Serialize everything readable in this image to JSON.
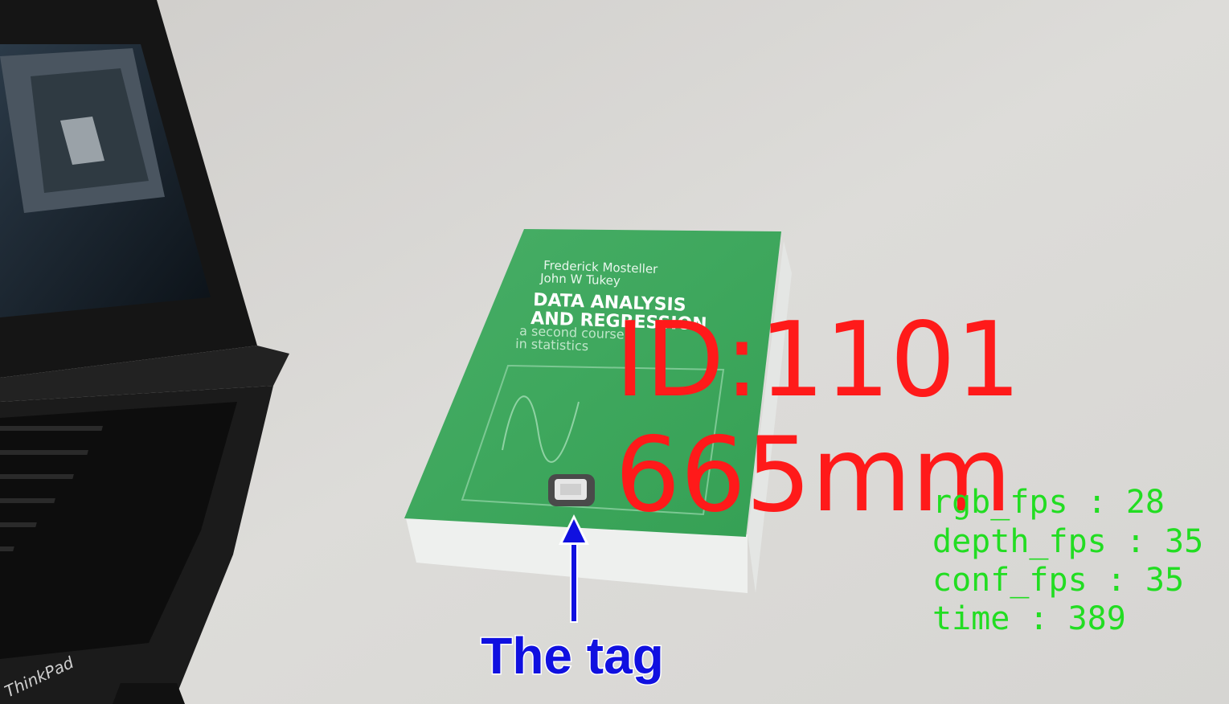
{
  "book": {
    "authors": [
      "Frederick Mosteller",
      "John W Tukey"
    ],
    "title_lines": [
      "DATA ANALYSIS",
      "AND REGRESSION"
    ],
    "subtitle_lines": [
      "a second course",
      "in statistics"
    ],
    "cover_color": "#3aa45a"
  },
  "laptop": {
    "brand": "ThinkPad"
  },
  "overlay": {
    "id_text": "ID:1101",
    "distance_text": "665mm",
    "id_color": "#ff1a1a",
    "hud_color": "#22dd22",
    "hud_lines": [
      "rgb_fps : 28",
      "depth_fps : 35",
      "conf_fps : 35",
      "time : 389"
    ]
  },
  "annotation": {
    "label": "The tag",
    "color": "#1010e0"
  }
}
